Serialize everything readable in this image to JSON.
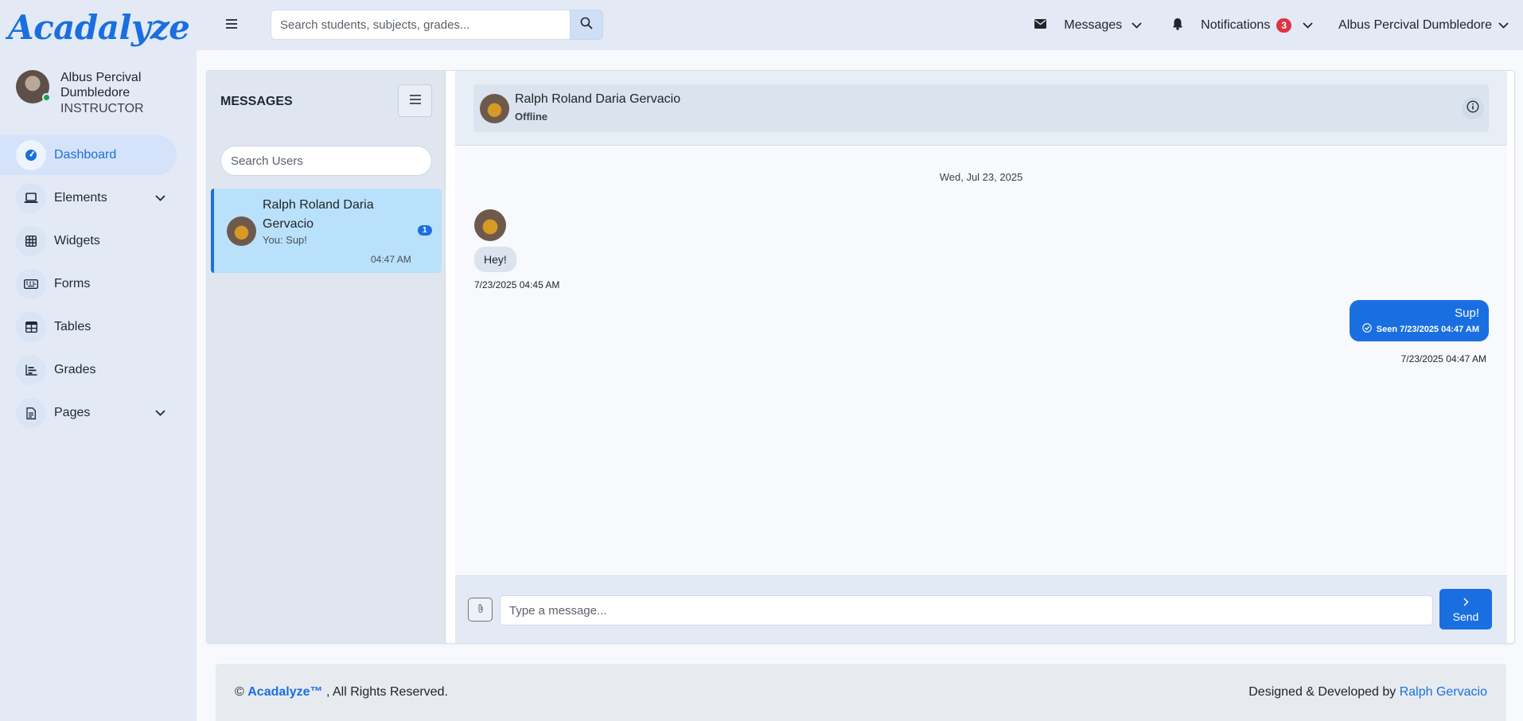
{
  "app": {
    "logo": "Acadalyze"
  },
  "profile": {
    "name": "Albus Percival Dumbledore",
    "role": "INSTRUCTOR"
  },
  "sidebar": {
    "items": [
      {
        "label": "Dashboard",
        "icon": "dashboard-gauge-icon",
        "active": true
      },
      {
        "label": "Elements",
        "icon": "laptop-icon",
        "has_submenu": true
      },
      {
        "label": "Widgets",
        "icon": "grid-icon"
      },
      {
        "label": "Forms",
        "icon": "keyboard-icon"
      },
      {
        "label": "Tables",
        "icon": "table-icon"
      },
      {
        "label": "Grades",
        "icon": "bar-chart-icon"
      },
      {
        "label": "Pages",
        "icon": "document-icon",
        "has_submenu": true
      }
    ]
  },
  "topbar": {
    "search_placeholder": "Search students, subjects, grades...",
    "messages_label": "Messages",
    "notifications_label": "Notifications",
    "notifications_count": "3",
    "user_name": "Albus Percival Dumbledore"
  },
  "messages_panel": {
    "title": "MESSAGES",
    "search_placeholder": "Search Users",
    "conversations": [
      {
        "name": "Ralph Roland Daria Gervacio",
        "preview": "You: Sup!",
        "unread": "1",
        "time": "04:47 AM"
      }
    ]
  },
  "chat": {
    "contact_name": "Ralph Roland Daria Gervacio",
    "contact_status": "Offline",
    "date_separator": "Wed, Jul 23, 2025",
    "incoming": {
      "text": "Hey!",
      "timestamp": "7/23/2025 04:45 AM"
    },
    "outgoing": {
      "text": "Sup!",
      "seen": "Seen 7/23/2025 04:47 AM",
      "timestamp": "7/23/2025 04:47 AM"
    },
    "input_placeholder": "Type a message...",
    "send_label": "Send"
  },
  "footer": {
    "copyright_symbol": "©",
    "brand": "Acadalyze™",
    "rights": ", All Rights Reserved.",
    "designed_by": "Designed & Developed by",
    "author": "Ralph Gervacio"
  },
  "colors": {
    "accent": "#1a6fe0",
    "sidebar_bg": "#e3eaf5",
    "badge_red": "#dc3545",
    "active_conversation": "#b9e1fb"
  }
}
